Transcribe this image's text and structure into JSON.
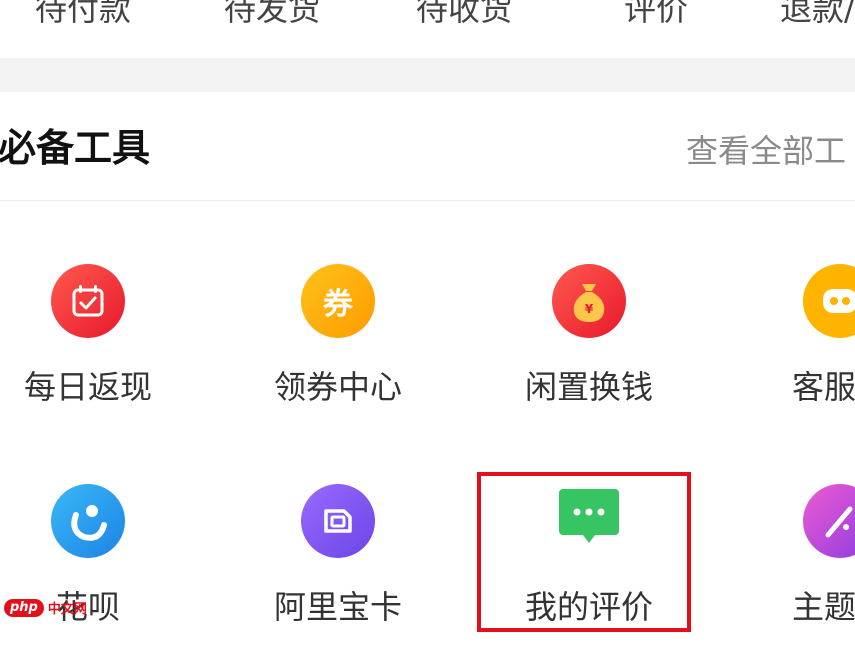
{
  "order_tabs": [
    "待付款",
    "待发货",
    "待收货",
    "评价",
    "退款/"
  ],
  "tools": {
    "title": "必备工具",
    "more_link": "查看全部工",
    "items": [
      {
        "label": "每日返现",
        "icon": "calendar-check-icon",
        "color": "#f3353f"
      },
      {
        "label": "领券中心",
        "icon": "coupon-icon",
        "color": "#ffa800"
      },
      {
        "label": "闲置换钱",
        "icon": "money-bag-icon",
        "color": "#f3353f"
      },
      {
        "label": "客服小",
        "icon": "chat-bot-icon",
        "color": "#ffb400"
      },
      {
        "label": "花呗",
        "icon": "huabei-icon",
        "color": "#2b9ef0"
      },
      {
        "label": "阿里宝卡",
        "icon": "sim-card-icon",
        "color": "#7a57f0"
      },
      {
        "label": "我的评价",
        "icon": "message-bubble-icon",
        "color": "#2bc45f"
      },
      {
        "label": "主题换",
        "icon": "palette-icon",
        "color": "#b34bd8"
      }
    ]
  },
  "watermark": {
    "badge": "php",
    "text": "中文网"
  }
}
